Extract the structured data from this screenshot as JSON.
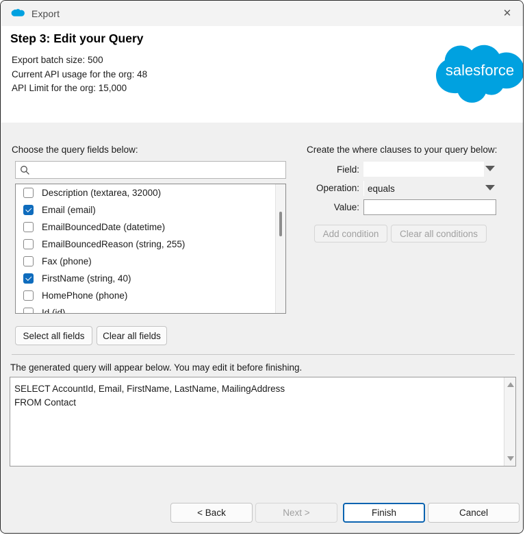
{
  "window": {
    "title": "Export",
    "title_icon": "salesforce-cloud-icon",
    "close_icon": "✕"
  },
  "header": {
    "step_title": "Step 3: Edit your Query",
    "meta": [
      "Export batch size: 500",
      "Current API usage for the org: 48",
      "API Limit for the org: 15,000"
    ],
    "logo_text": "salesforce",
    "brand_color": "#00A1E0"
  },
  "left_panel": {
    "label": "Choose the query fields below:",
    "search": {
      "value": "",
      "placeholder": "",
      "icon": "search-icon"
    },
    "fields": [
      {
        "label": "Description (textarea, 32000)",
        "checked": false
      },
      {
        "label": "Email (email)",
        "checked": true
      },
      {
        "label": "EmailBouncedDate (datetime)",
        "checked": false
      },
      {
        "label": "EmailBouncedReason (string, 255)",
        "checked": false
      },
      {
        "label": "Fax (phone)",
        "checked": false
      },
      {
        "label": "FirstName (string, 40)",
        "checked": true
      },
      {
        "label": "HomePhone (phone)",
        "checked": false
      },
      {
        "label": "Id (id)",
        "checked": false
      }
    ],
    "select_all_label": "Select all fields",
    "clear_all_label": "Clear all fields",
    "checkbox_accent": "#0f6cbd"
  },
  "right_panel": {
    "label": "Create the where clauses to your query below:",
    "field_label": "Field:",
    "field_value": "",
    "operation_label": "Operation:",
    "operation_value": "equals",
    "value_label": "Value:",
    "value_value": "",
    "value_placeholder": "",
    "add_condition_label": "Add condition",
    "clear_conditions_label": "Clear all conditions"
  },
  "query": {
    "note": "The generated query will appear below.  You may edit it before finishing.",
    "text": "SELECT AccountId, Email, FirstName, LastName, MailingAddress\nFROM Contact"
  },
  "footer": {
    "back_label": "< Back",
    "next_label": "Next >",
    "finish_label": "Finish",
    "cancel_label": "Cancel"
  }
}
